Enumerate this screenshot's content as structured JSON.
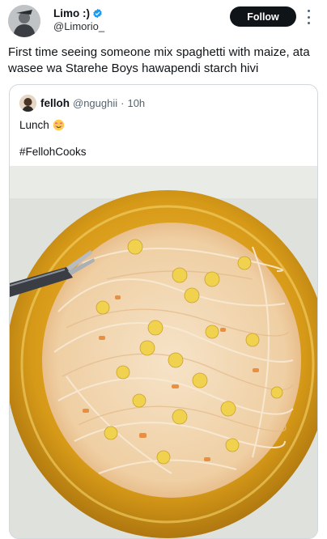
{
  "author": {
    "name": "Limo :)",
    "handle": "@Limorio_"
  },
  "follow_label": "Follow",
  "tweet_text": "First time seeing someone mix spaghetti with maize, ata wasee wa Starehe Boys hawapendi starch hivi",
  "quoted": {
    "name": "felloh",
    "handle": "@ngughii",
    "separator": "·",
    "time": "10h",
    "line1": "Lunch",
    "line2": "#FellohCooks"
  },
  "colors": {
    "follow_bg": "#0f1419",
    "verified_blue": "#1d9bf0",
    "border": "#cfd9de"
  },
  "icons": [
    "verified-badge-icon",
    "more-options-icon",
    "smiling-face-emoji-icon"
  ]
}
